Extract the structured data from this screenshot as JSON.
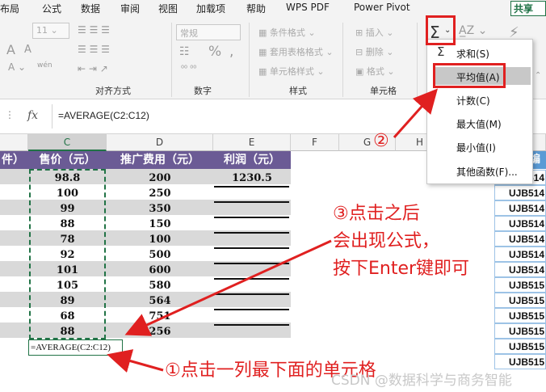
{
  "menu": [
    "布局",
    "公式",
    "数据",
    "审阅",
    "视图",
    "加载项",
    "帮助",
    "WPS PDF",
    "Power Pivot"
  ],
  "share": "共享",
  "ribbon": {
    "font_size": "11",
    "number_format": "常规",
    "percent": "%",
    "comma": ",",
    "cond_fmt": "条件格式",
    "table_fmt": "套用表格格式",
    "cell_style": "单元格样式",
    "insert": "插入",
    "delete": "删除",
    "format": "格式",
    "groups": {
      "align": "对齐方式",
      "number": "数字",
      "styles": "样式",
      "cells": "单元格"
    }
  },
  "autosum_menu": {
    "items": [
      "求和(S)",
      "平均值(A)",
      "计数(C)",
      "最大值(M)",
      "最小值(I)",
      "其他函数(F)..."
    ],
    "selected": "平均值(A)"
  },
  "formula_bar": {
    "fx": "fx",
    "formula": "=AVERAGE(C2:C12)"
  },
  "columns": [
    "C",
    "D",
    "E",
    "F",
    "G",
    "H"
  ],
  "headers": {
    "b": "件）",
    "c": "售价（元）",
    "d": "推广费用（元）",
    "e": "利润（元）"
  },
  "rows": [
    {
      "c": "98.8",
      "d": "200",
      "e": "1230.5"
    },
    {
      "c": "100",
      "d": "250",
      "e": ""
    },
    {
      "c": "99",
      "d": "350",
      "e": ""
    },
    {
      "c": "88",
      "d": "150",
      "e": ""
    },
    {
      "c": "78",
      "d": "100",
      "e": ""
    },
    {
      "c": "92",
      "d": "500",
      "e": ""
    },
    {
      "c": "101",
      "d": "600",
      "e": ""
    },
    {
      "c": "105",
      "d": "580",
      "e": ""
    },
    {
      "c": "89",
      "d": "564",
      "e": ""
    },
    {
      "c": "68",
      "d": "751",
      "e": ""
    },
    {
      "c": "88",
      "d": "256",
      "e": ""
    }
  ],
  "active_cell": "=AVERAGE(C2:C12)",
  "codes": [
    "UJB514",
    "UJB514",
    "UJB514",
    "UJB514",
    "UJB514",
    "UJB514",
    "UJB514",
    "UJB515",
    "UJB515",
    "UJB515",
    "UJB515",
    "UJB515",
    "UJB515"
  ],
  "code_header": "编",
  "annotations": {
    "step1": "①点击一列最下面的单元格",
    "step2": "②",
    "step3": [
      "③点击之后",
      "会出现公式，",
      "按下Enter键即可"
    ]
  },
  "watermark": "CSDN @数据科学与商务智能",
  "colors": {
    "header_purple": "#6b5b95",
    "excel_green": "#217346",
    "red": "#e02020"
  }
}
